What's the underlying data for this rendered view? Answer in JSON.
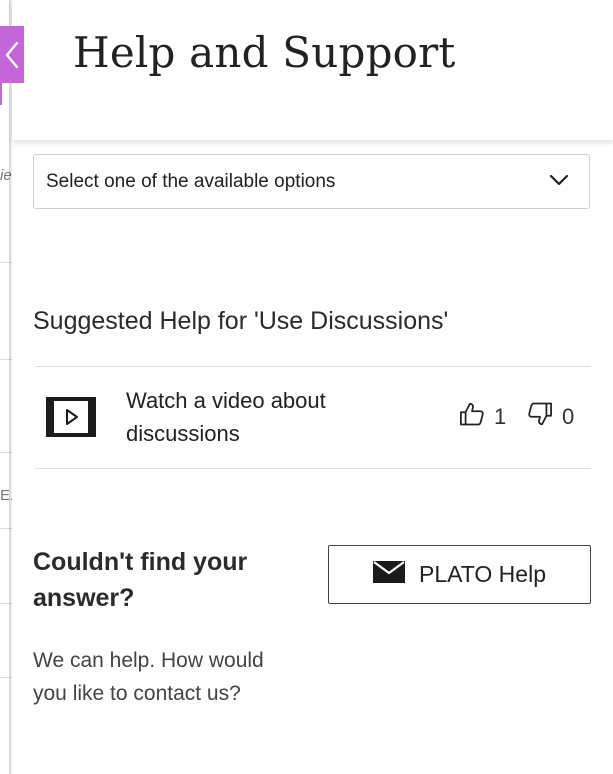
{
  "panel": {
    "title": "Help and Support"
  },
  "topic_select": {
    "selected": "Select one of the available options",
    "icon": "chevron-down-icon"
  },
  "suggested": {
    "heading": "Suggested Help for 'Use Discussions'",
    "items": [
      {
        "type_icon": "video-icon",
        "line1": "Watch a video about",
        "line2": "discussions",
        "thumbs_up": "1",
        "thumbs_down": "0"
      }
    ]
  },
  "contact": {
    "heading_line1": "Couldn't find your",
    "heading_line2": "answer?",
    "text_line1": "We can help. How would",
    "text_line2": "you like to contact us?",
    "button_label": "PLATO Help",
    "button_icon": "envelope-icon"
  },
  "background_page": {
    "fragment_1": "ie",
    "fragment_2": "E."
  },
  "colors": {
    "accent": "#c466d8"
  }
}
